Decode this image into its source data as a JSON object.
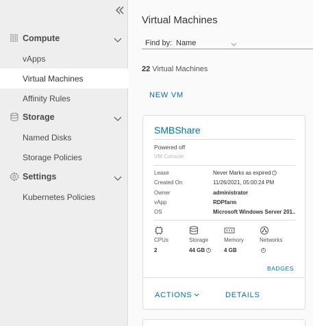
{
  "sidebar": {
    "groups": [
      {
        "label": "Compute",
        "icon": "compute-grid-icon",
        "items": [
          {
            "label": "vApps"
          },
          {
            "label": "Virtual Machines",
            "active": true
          },
          {
            "label": "Affinity Rules"
          }
        ]
      },
      {
        "label": "Storage",
        "icon": "storage-database-icon",
        "items": [
          {
            "label": "Named Disks"
          },
          {
            "label": "Storage Policies"
          }
        ]
      },
      {
        "label": "Settings",
        "icon": "settings-gear-icon",
        "items": [
          {
            "label": "Kubernetes Policies"
          }
        ]
      }
    ]
  },
  "main": {
    "title": "Virtual Machines",
    "find_by": {
      "label": "Find by:",
      "value": "Name"
    },
    "count": {
      "number": "22",
      "text": "Virtual Machines"
    },
    "new_vm_label": "NEW VM",
    "card": {
      "name": "SMBShare",
      "status": "Powered off",
      "console_label": "VM Console",
      "properties": [
        {
          "key": "Lease",
          "value": "Never Marks as expired",
          "info": true
        },
        {
          "key": "Created On",
          "value": "11/26/2021, 05:00:24 PM"
        },
        {
          "key": "Owner",
          "value": "administrator",
          "bold": true
        },
        {
          "key": "vApp",
          "value": "RDPfarm",
          "bold": true
        },
        {
          "key": "OS",
          "value": "Microsoft Windows Server 201..",
          "bold": true
        }
      ],
      "stats": [
        {
          "label": "CPUs",
          "value": "2",
          "icon": "cpu-icon"
        },
        {
          "label": "Storage",
          "value": "44 GB",
          "icon": "storage-icon",
          "info": true
        },
        {
          "label": "Memory",
          "value": "4 GB",
          "icon": "memory-icon"
        },
        {
          "label": "Networks",
          "value": "",
          "icon": "network-icon",
          "info": true
        }
      ],
      "badges_label": "BADGES",
      "actions_label": "ACTIONS",
      "details_label": "DETAILS"
    }
  }
}
